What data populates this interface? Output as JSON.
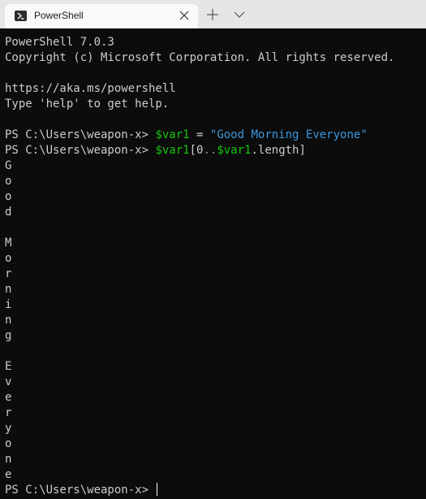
{
  "tab": {
    "title": "PowerShell",
    "icon": "powershell-icon",
    "close_icon": "close-icon",
    "new_tab_icon": "plus-icon",
    "dropdown_icon": "chevron-down-icon"
  },
  "terminal": {
    "banner": [
      "PowerShell 7.0.3",
      "Copyright (c) Microsoft Corporation. All rights reserved.",
      "",
      "https://aka.ms/powershell",
      "Type 'help' to get help.",
      ""
    ],
    "prompt": "PS C:\\Users\\weapon-x> ",
    "cmd1": {
      "var": "$var1",
      "op": " = ",
      "string": "\"Good Morning Everyone\""
    },
    "cmd2": {
      "var": "$var1",
      "open": "[",
      "start": "0",
      "range": "..",
      "var2": "$var1",
      "prop": ".length]"
    },
    "output": [
      "G",
      "o",
      "o",
      "d",
      " ",
      "M",
      "o",
      "r",
      "n",
      "i",
      "n",
      "g",
      " ",
      "E",
      "v",
      "e",
      "r",
      "y",
      "o",
      "n",
      "e"
    ],
    "final_prompt": "PS C:\\Users\\weapon-x> "
  },
  "colors": {
    "background": "#0c0c0c",
    "text": "#cccccc",
    "variable": "#16c60c",
    "string": "#3a96dd",
    "titlebar": "#e6e6e6",
    "tab": "#f9f9f9"
  }
}
